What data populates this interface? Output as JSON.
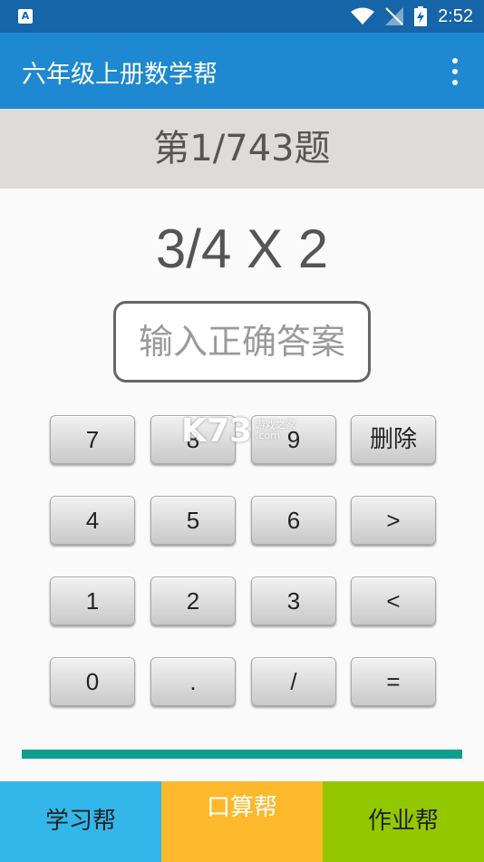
{
  "statusbar": {
    "time": "2:52",
    "icons": [
      "app-a-icon",
      "wifi-icon",
      "no-signal-icon",
      "battery-charging-icon"
    ]
  },
  "appbar": {
    "title": "六年级上册数学帮",
    "menu_icon": "more-vert-icon"
  },
  "quiz": {
    "counter": "第1/743题",
    "question": "3/4 X 2",
    "answer_placeholder": "输入正确答案"
  },
  "keypad": {
    "keys": [
      "7",
      "8",
      "9",
      "删除",
      "4",
      "5",
      "6",
      ">",
      "1",
      "2",
      "3",
      "<",
      "0",
      ".",
      "/",
      "="
    ]
  },
  "watermark": {
    "logo": "K73",
    "site_cn": "游戏之家",
    "site": ".com"
  },
  "progress": {
    "value": 1.0,
    "color": "#0e9e8e"
  },
  "bottom_nav": {
    "study": "学习帮",
    "oral": "口算帮",
    "homework": "作业帮"
  },
  "colors": {
    "statusbar": "#1565a8",
    "appbar": "#1e88d0",
    "study": "#33b7ea",
    "oral": "#fbb92b",
    "homework": "#93c800"
  }
}
